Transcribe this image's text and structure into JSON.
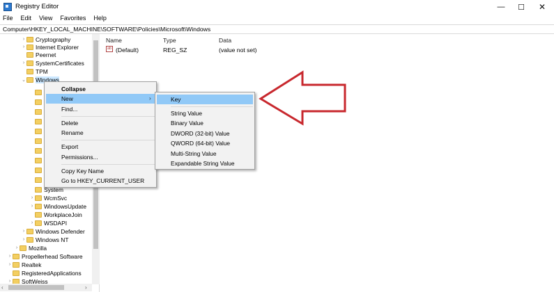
{
  "window": {
    "title": "Registry Editor",
    "minimize": "—",
    "maximize": "☐",
    "close": "✕"
  },
  "menu": [
    "File",
    "Edit",
    "View",
    "Favorites",
    "Help"
  ],
  "address": "Computer\\HKEY_LOCAL_MACHINE\\SOFTWARE\\Policies\\Microsoft\\Windows",
  "tree": [
    {
      "label": "Cryptography",
      "chevron": "›"
    },
    {
      "label": "Internet Explorer",
      "chevron": "›"
    },
    {
      "label": "Peernet",
      "chevron": ""
    },
    {
      "label": "SystemCertificates",
      "chevron": "›"
    },
    {
      "label": "TPM",
      "chevron": ""
    },
    {
      "label": "Windows",
      "chevron": "⌄"
    },
    {
      "label": "System",
      "chevron": ""
    },
    {
      "label": "WcmSvc",
      "chevron": "›"
    },
    {
      "label": "WindowsUpdate",
      "chevron": "›"
    },
    {
      "label": "WorkplaceJoin",
      "chevron": ""
    },
    {
      "label": "WSDAPI",
      "chevron": "›"
    },
    {
      "label": "Windows Defender",
      "chevron": "›"
    },
    {
      "label": "Windows NT",
      "chevron": "›"
    },
    {
      "label": "Mozilla",
      "chevron": "›"
    },
    {
      "label": "Propellerhead Software",
      "chevron": "›"
    },
    {
      "label": "Realtek",
      "chevron": "›"
    },
    {
      "label": "RegisteredApplications",
      "chevron": ""
    },
    {
      "label": "SoftWeiss",
      "chevron": "›"
    }
  ],
  "list": {
    "headers": {
      "name": "Name",
      "type": "Type",
      "data": "Data"
    },
    "rows": [
      {
        "icon": "ab",
        "name": "(Default)",
        "type": "REG_SZ",
        "data": "(value not set)"
      }
    ]
  },
  "context_menu": [
    {
      "label": "Collapse",
      "bold": true
    },
    {
      "label": "New",
      "submenu_arrow": "›",
      "highlighted": true
    },
    {
      "label": "Find..."
    },
    {
      "label": "Delete"
    },
    {
      "label": "Rename"
    },
    {
      "label": "Export"
    },
    {
      "label": "Permissions..."
    },
    {
      "label": "Copy Key Name"
    },
    {
      "label": "Go to HKEY_CURRENT_USER"
    }
  ],
  "submenu": [
    {
      "label": "Key",
      "highlighted": true
    },
    {
      "label": "String Value"
    },
    {
      "label": "Binary Value"
    },
    {
      "label": "DWORD (32-bit) Value"
    },
    {
      "label": "QWORD (64-bit) Value"
    },
    {
      "label": "Multi-String Value"
    },
    {
      "label": "Expandable String Value"
    }
  ],
  "colors": {
    "highlight": "#91c9f7",
    "annotation_arrow": "#c8282e",
    "folder": "#f3cf62"
  },
  "scroll": {
    "left_arrow": "‹",
    "right_arrow": "›"
  }
}
